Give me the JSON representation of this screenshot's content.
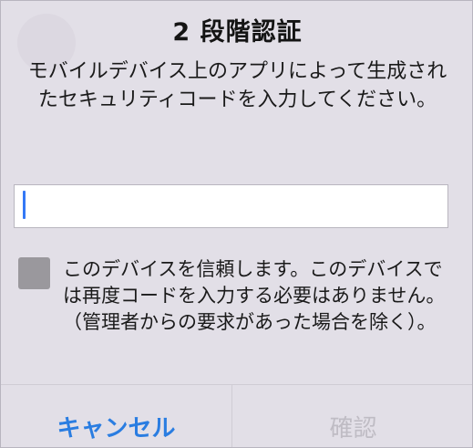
{
  "dialog": {
    "title": "2 段階認証",
    "message": "モバイルデバイス上のアプリによって生成されたセキュリティコードを入力してください。",
    "code_input": {
      "value": "",
      "placeholder": ""
    },
    "remember_device": {
      "checked": false,
      "label": "このデバイスを信頼します。このデバイスでは再度コードを入力する必要はありません。（管理者からの要求があった場合を除く）。"
    },
    "buttons": {
      "cancel_label": "キャンセル",
      "confirm_label": "確認"
    }
  },
  "colors": {
    "dialog_background": "#e2dfe7",
    "accent": "#2a7de1",
    "caret": "#3478f6",
    "disabled_text": "#bfbcc4",
    "checkbox": "#9a989d"
  }
}
